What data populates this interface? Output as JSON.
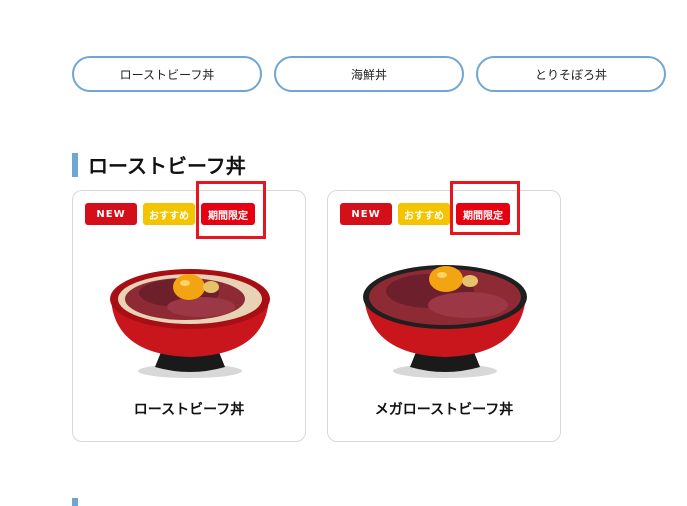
{
  "category_tabs": [
    {
      "label": "ローストビーフ丼"
    },
    {
      "label": "海鮮丼"
    },
    {
      "label": "とりそぼろ丼"
    }
  ],
  "section": {
    "title": "ローストビーフ丼"
  },
  "products": [
    {
      "name": "ローストビーフ丼",
      "badges": {
        "new": "NEW",
        "recommend": "おすすめ",
        "limited": "期間限定"
      }
    },
    {
      "name": "メガローストビーフ丼",
      "badges": {
        "new": "NEW",
        "recommend": "おすすめ",
        "limited": "期間限定"
      }
    }
  ],
  "colors": {
    "accent_blue": "#6fa6d6",
    "badge_new": "#d40f1a",
    "badge_recommend": "#f4c400",
    "badge_limited": "#e60012",
    "highlight_box": "#e8141e"
  }
}
